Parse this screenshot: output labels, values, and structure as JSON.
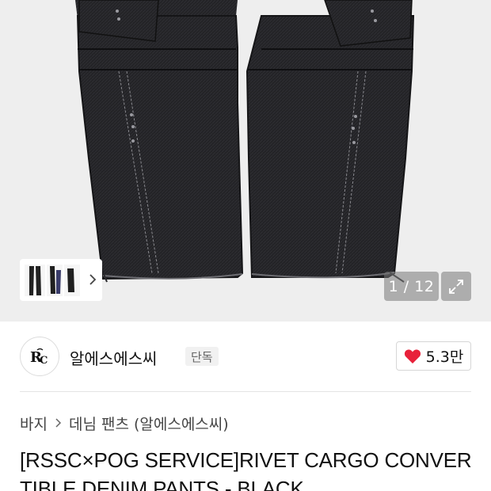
{
  "gallery": {
    "counter": "1 / 12",
    "thumbnail_alt": "product thumbnails",
    "next_icon": "chevron-right-icon",
    "expand_icon": "expand-icon"
  },
  "brand": {
    "logo_text": "R̃C",
    "name": "알에스에스씨",
    "badge": "단독"
  },
  "like": {
    "icon": "heart-icon",
    "color": "#e8213a",
    "count": "5.3만"
  },
  "breadcrumb": {
    "items": [
      "바지",
      "데님 팬츠 (알에스에스씨)"
    ]
  },
  "product": {
    "title": "[RSSC×POG SERVICE]RIVET CARGO CONVERTIBLE DENIM PANTS - BLACK"
  }
}
